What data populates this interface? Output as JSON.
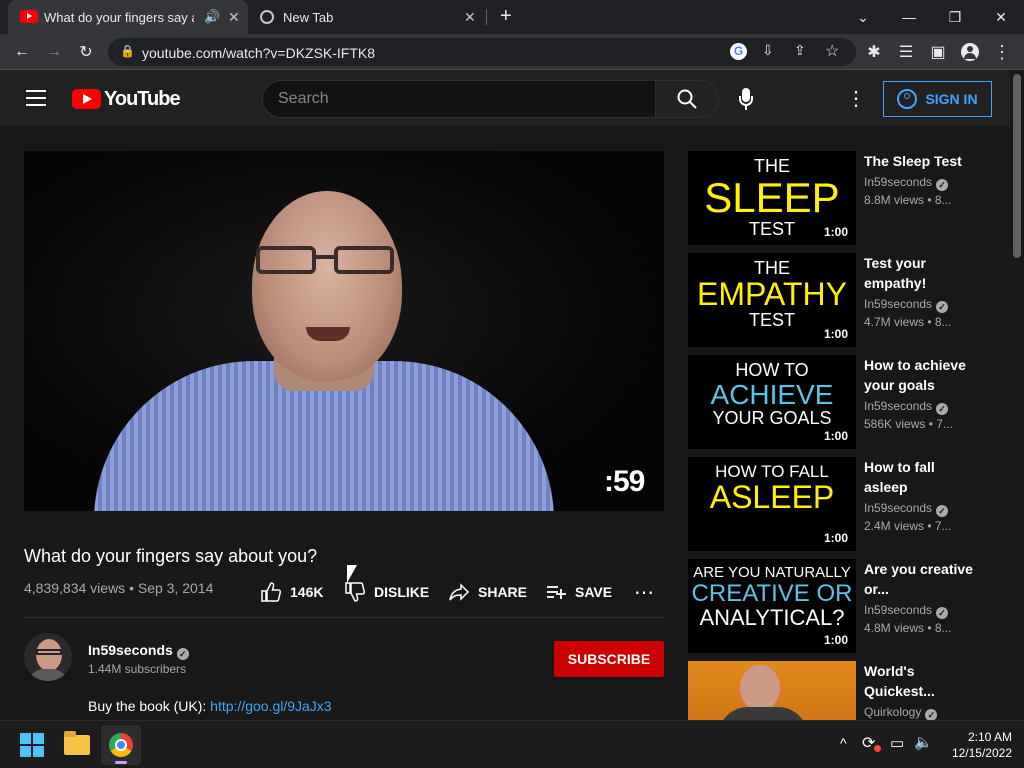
{
  "browser": {
    "tabs": [
      {
        "title": "What do your fingers say about you?",
        "active": true
      },
      {
        "title": "New Tab",
        "active": false
      }
    ],
    "url": "youtube.com/watch?v=DKZSK-IFTK8"
  },
  "youtube": {
    "logo_text": "YouTube",
    "search_placeholder": "Search",
    "signin_label": "SIGN IN",
    "colors": {
      "brand_red": "#ff0000",
      "link_blue": "#3ea6ff",
      "subscribe_red": "#cc0000"
    }
  },
  "video": {
    "title": "What do your fingers say about you?",
    "stats": "4,839,834 views • Sep 3, 2014",
    "watermark": ":59",
    "likes": "146K",
    "dislike_label": "DISLIKE",
    "share_label": "SHARE",
    "save_label": "SAVE"
  },
  "channel": {
    "name": "In59seconds",
    "subscribers": "1.44M subscribers",
    "subscribe_label": "SUBSCRIBE",
    "description_prefix": "Buy the book (UK): ",
    "description_link": "http://goo.gl/9JaJx3"
  },
  "recommendations": [
    {
      "title": "The Sleep Test",
      "channel": "In59seconds",
      "stats": "8.8M views • 8...",
      "duration": "1:00",
      "thumb_lines": [
        "THE",
        "SLEEP",
        "TEST"
      ],
      "thumb_color": "#fff200"
    },
    {
      "title": "Test your empathy!",
      "channel": "In59seconds",
      "stats": "4.7M views • 8...",
      "duration": "1:00",
      "thumb_lines": [
        "THE",
        "EMPATHY",
        "TEST"
      ],
      "thumb_color": "#fff200"
    },
    {
      "title": "How to achieve your goals",
      "channel": "In59seconds",
      "stats": "586K views • 7...",
      "duration": "1:00",
      "thumb_lines": [
        "HOW TO",
        "ACHIEVE",
        "YOUR GOALS"
      ],
      "thumb_color": "#5bc4e8"
    },
    {
      "title": "How to fall asleep",
      "channel": "In59seconds",
      "stats": "2.4M views • 7...",
      "duration": "1:00",
      "thumb_lines": [
        "HOW TO FALL",
        "ASLEEP",
        ""
      ],
      "thumb_color": "#fff200"
    },
    {
      "title": "Are you creative or...",
      "channel": "In59seconds",
      "stats": "4.8M views • 8...",
      "duration": "1:00",
      "thumb_lines": [
        "ARE YOU NATURALLY",
        "CREATIVE OR",
        "ANALYTICAL?"
      ],
      "thumb_color": "#5bc4e8"
    },
    {
      "title": "World's Quickest...",
      "channel": "Quirkology",
      "stats": "",
      "duration": "",
      "thumb_lines": [
        "",
        "",
        ""
      ],
      "thumb_color": "#ffffff"
    }
  ],
  "taskbar": {
    "time": "2:10 AM",
    "date": "12/15/2022"
  }
}
